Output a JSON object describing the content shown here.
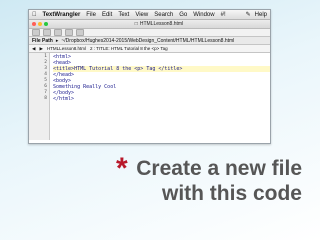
{
  "menubar": {
    "apple": "",
    "app": "TextWrangler",
    "items": [
      "File",
      "Edit",
      "Text",
      "View",
      "Search",
      "Go",
      "Window",
      "#!",
      "Help"
    ]
  },
  "doc_title": "HTMLLesson8.html",
  "pathbar": {
    "label": "File Path",
    "path": "~/Dropbox/Hughes2014-2015/WebDesign_Content/HTML/HTMLLesson8.html"
  },
  "navbar": {
    "file": "HTMLLesson8.html",
    "position": "2 : TITLE: HTML Tutorial 8 the <p> Tag"
  },
  "gutter": [
    "1",
    "2",
    "3",
    "4",
    "5",
    "6",
    "7",
    "8"
  ],
  "code": [
    "<html>",
    "<head>",
    "<title>HTML Tutorial 8 the <p> Tag </title>",
    "</head>",
    "<body>",
    "Something Really Cool",
    "</body>",
    "</html>"
  ],
  "slide": {
    "bullet": "*",
    "title_line1": "Create a new file",
    "title_line2": "with this code"
  },
  "colors": {
    "accent": "#b8182a",
    "title_text": "#565656",
    "current_line": "#fff9c7"
  }
}
